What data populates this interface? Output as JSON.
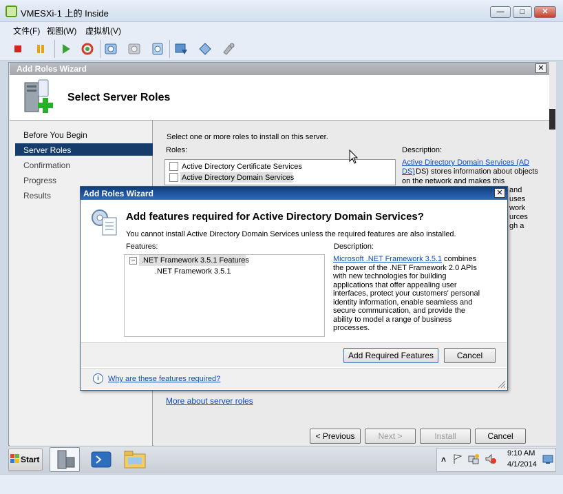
{
  "host": {
    "title": "VMESXi-1 上的 Inside",
    "menu": [
      "文件(F)",
      "视图(W)",
      "虚拟机(V)"
    ],
    "min_label": "—",
    "max_label": "□",
    "close_label": "✕"
  },
  "wizard": {
    "title": "Add Roles Wizard",
    "close_label": "✕",
    "heading": "Select Server Roles",
    "nav": [
      "Before You Begin",
      "Server Roles",
      "Confirmation",
      "Progress",
      "Results"
    ],
    "instruction": "Select one or more roles to install on this server.",
    "roles_label": "Roles:",
    "roles": [
      "Active Directory Certificate Services",
      "Active Directory Domain Services"
    ],
    "description_label": "Description:",
    "desc_link": "Active Directory Domain Services (AD DS)",
    "desc_line2": "DS) stores information about objects",
    "desc_line3": "on the network and makes this",
    "desc_partial": [
      "and",
      "uses",
      "work",
      "urces",
      "gh a"
    ],
    "more_link": "More about server roles",
    "buttons": {
      "previous": "< Previous",
      "next": "Next >",
      "install": "Install",
      "cancel": "Cancel"
    }
  },
  "dialog": {
    "title": "Add Roles Wizard",
    "close_label": "✕",
    "heading": "Add features required for Active Directory Domain Services?",
    "subtext": "You cannot install Active Directory Domain Services unless the required features are also installed.",
    "features_label": "Features:",
    "description_label": "Description:",
    "tree": {
      "expander": "−",
      "parent": ".NET Framework 3.5.1 Features",
      "child": ".NET Framework 3.5.1"
    },
    "desc_link": "Microsoft .NET Framework 3.5.1",
    "desc_lines": [
      " combines",
      "the power of the .NET Framework 2.0 APIs",
      "with new technologies for building",
      "applications that offer appealing user",
      "interfaces, protect your customers' personal",
      "identity information, enable seamless and",
      "secure communication, and provide the",
      "ability to model a range of business",
      "processes."
    ],
    "add_button": "Add Required Features",
    "cancel_button": "Cancel",
    "info_icon_text": "i",
    "info_link": "Why are these features required?"
  },
  "taskbar": {
    "start_label": "Start",
    "tray_arrow": "˄",
    "time": "9:10 AM",
    "date": "4/1/2014"
  },
  "colors": {
    "accent": "#163c6c",
    "link": "#0c4ec2",
    "dialog_title": "#1b4f93"
  }
}
